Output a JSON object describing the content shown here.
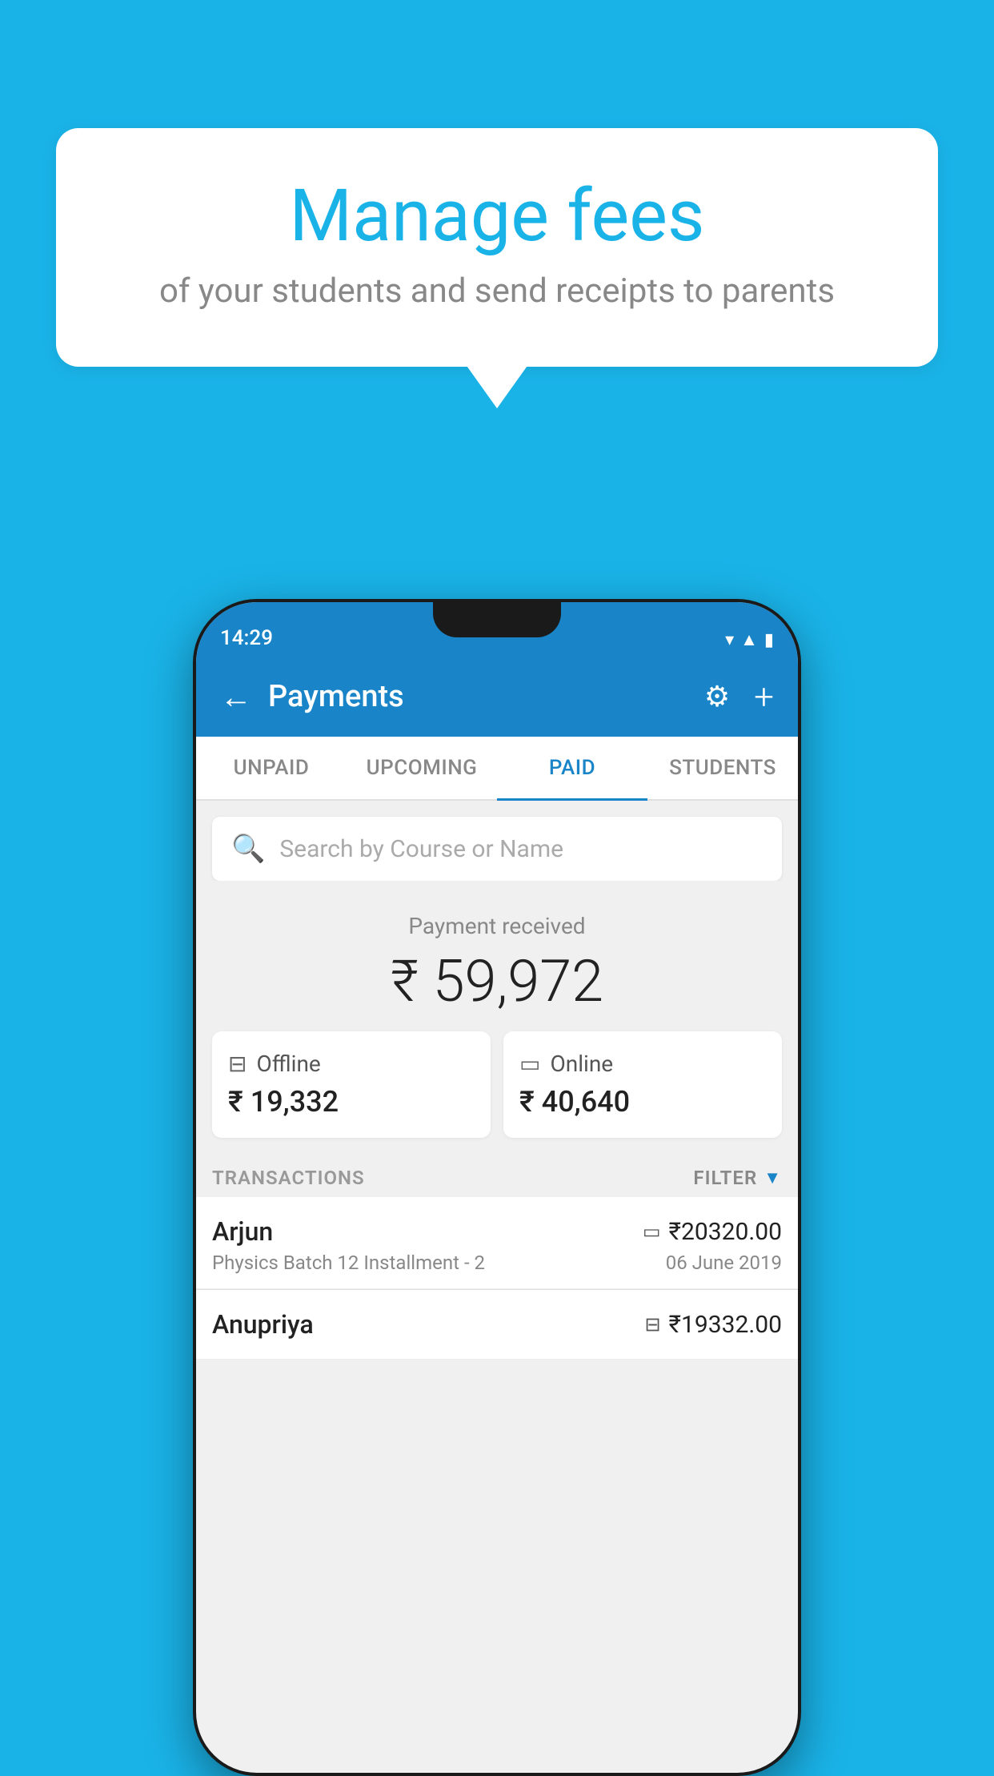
{
  "background_color": "#1ab3e8",
  "speech_bubble": {
    "title": "Manage fees",
    "subtitle": "of your students and send receipts to parents"
  },
  "status_bar": {
    "time": "14:29",
    "icons": [
      "wifi",
      "signal",
      "battery"
    ]
  },
  "header": {
    "title": "Payments",
    "back_label": "←",
    "settings_label": "⚙",
    "add_label": "+"
  },
  "tabs": [
    {
      "label": "UNPAID",
      "active": false
    },
    {
      "label": "UPCOMING",
      "active": false
    },
    {
      "label": "PAID",
      "active": true
    },
    {
      "label": "STUDENTS",
      "active": false
    }
  ],
  "search": {
    "placeholder": "Search by Course or Name"
  },
  "payment_received": {
    "label": "Payment received",
    "amount": "₹ 59,972",
    "offline": {
      "type": "Offline",
      "amount": "₹ 19,332"
    },
    "online": {
      "type": "Online",
      "amount": "₹ 40,640"
    }
  },
  "transactions": {
    "label": "TRANSACTIONS",
    "filter_label": "FILTER",
    "rows": [
      {
        "name": "Arjun",
        "detail": "Physics Batch 12 Installment - 2",
        "amount": "₹20320.00",
        "date": "06 June 2019",
        "type_icon": "card"
      },
      {
        "name": "Anupriya",
        "detail": "",
        "amount": "₹19332.00",
        "date": "",
        "type_icon": "cash"
      }
    ]
  }
}
